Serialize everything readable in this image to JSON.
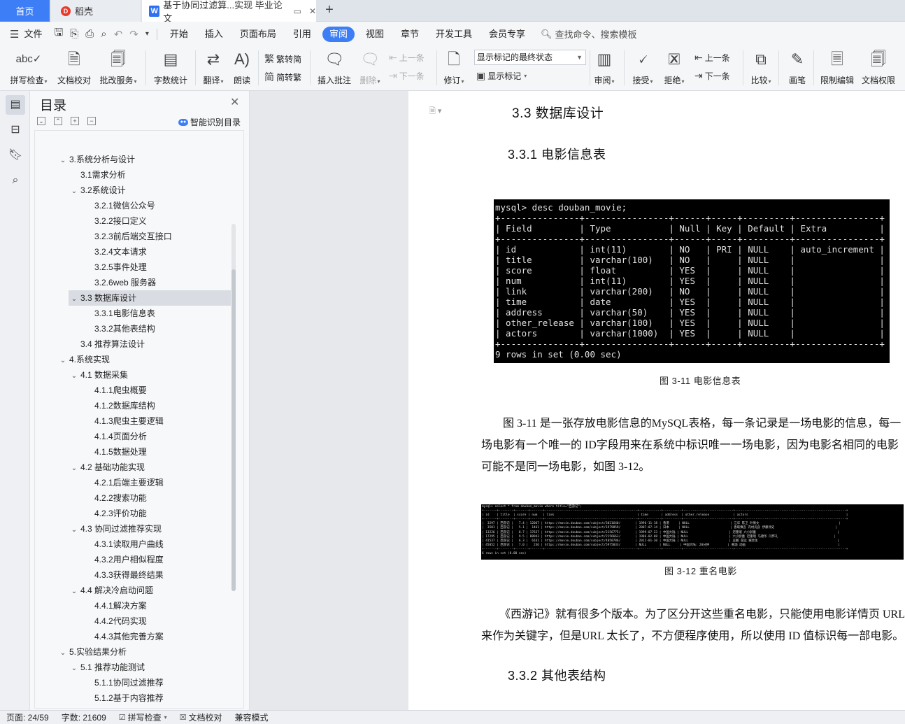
{
  "titlebar": {
    "home_tab": "首页",
    "daoke_tab": "稻壳",
    "doc_tab": "基于协同过滤算...实现 毕业论文",
    "add_tab": "+"
  },
  "menubar": {
    "file": "文件",
    "items": [
      "开始",
      "插入",
      "页面布局",
      "引用",
      "审阅",
      "视图",
      "章节",
      "开发工具",
      "会员专享"
    ],
    "active_item": "审阅",
    "search_placeholder": "查找命令、搜索模板"
  },
  "ribbon": {
    "spell_check": "拼写检查",
    "doc_check": "文档校对",
    "batch_service": "批改服务",
    "word_count": "字数统计",
    "translate": "翻译",
    "read_aloud": "朗读",
    "trad_to_simp_top": "繁转简",
    "simp_to_trad": "简转繁",
    "insert_comment": "插入批注",
    "delete": "删除",
    "prev_comment": "上一条",
    "next_comment": "下一条",
    "track_changes": "修订",
    "markup_state": "显示标记的最终状态",
    "show_markup": "显示标记",
    "review": "审阅",
    "accept": "接受",
    "reject": "拒绝",
    "prev_change": "上一条",
    "next_change": "下一条",
    "compare": "比较",
    "pen": "画笔",
    "restrict_edit": "限制编辑",
    "doc_permission": "文档权限"
  },
  "toc": {
    "title": "目录",
    "smart_toc": "智能识别目录",
    "items": [
      {
        "text": "3.系统分析与设计",
        "level": 1,
        "chevron": true,
        "selected": false
      },
      {
        "text": "3.1需求分析",
        "level": 2,
        "chevron": false,
        "selected": false
      },
      {
        "text": "3.2系统设计",
        "level": 2,
        "chevron": true,
        "selected": false
      },
      {
        "text": "3.2.1微信公众号",
        "level": 3,
        "chevron": false,
        "selected": false
      },
      {
        "text": "3.2.2接口定义",
        "level": 3,
        "chevron": false,
        "selected": false
      },
      {
        "text": "3.2.3前后端交互接口",
        "level": 3,
        "chevron": false,
        "selected": false
      },
      {
        "text": "3.2.4文本请求",
        "level": 3,
        "chevron": false,
        "selected": false
      },
      {
        "text": "3.2.5事件处理",
        "level": 3,
        "chevron": false,
        "selected": false
      },
      {
        "text": "3.2.6web 服务器",
        "level": 3,
        "chevron": false,
        "selected": false
      },
      {
        "text": "3.3 数据库设计",
        "level": 2,
        "chevron": true,
        "selected": true
      },
      {
        "text": "3.3.1电影信息表",
        "level": 3,
        "chevron": false,
        "selected": false
      },
      {
        "text": "3.3.2其他表结构",
        "level": 3,
        "chevron": false,
        "selected": false
      },
      {
        "text": "3.4 推荐算法设计",
        "level": 2,
        "chevron": false,
        "selected": false
      },
      {
        "text": "4.系统实现",
        "level": 1,
        "chevron": true,
        "selected": false
      },
      {
        "text": "4.1 数据采集",
        "level": 2,
        "chevron": true,
        "selected": false
      },
      {
        "text": "4.1.1爬虫概要",
        "level": 3,
        "chevron": false,
        "selected": false
      },
      {
        "text": "4.1.2数据库结构",
        "level": 3,
        "chevron": false,
        "selected": false
      },
      {
        "text": "4.1.3爬虫主要逻辑",
        "level": 3,
        "chevron": false,
        "selected": false
      },
      {
        "text": "4.1.4页面分析",
        "level": 3,
        "chevron": false,
        "selected": false
      },
      {
        "text": "4.1.5数据处理",
        "level": 3,
        "chevron": false,
        "selected": false
      },
      {
        "text": "4.2 基础功能实现",
        "level": 2,
        "chevron": true,
        "selected": false
      },
      {
        "text": "4.2.1后端主要逻辑",
        "level": 3,
        "chevron": false,
        "selected": false
      },
      {
        "text": "4.2.2搜索功能",
        "level": 3,
        "chevron": false,
        "selected": false
      },
      {
        "text": "4.2.3评价功能",
        "level": 3,
        "chevron": false,
        "selected": false
      },
      {
        "text": "4.3 协同过滤推荐实现",
        "level": 2,
        "chevron": true,
        "selected": false
      },
      {
        "text": "4.3.1读取用户曲线",
        "level": 3,
        "chevron": false,
        "selected": false
      },
      {
        "text": "4.3.2用户相似程度",
        "level": 3,
        "chevron": false,
        "selected": false
      },
      {
        "text": "4.3.3获得最终结果",
        "level": 3,
        "chevron": false,
        "selected": false
      },
      {
        "text": "4.4 解决冷启动问题",
        "level": 2,
        "chevron": true,
        "selected": false
      },
      {
        "text": "4.4.1解决方案",
        "level": 3,
        "chevron": false,
        "selected": false
      },
      {
        "text": "4.4.2代码实现",
        "level": 3,
        "chevron": false,
        "selected": false
      },
      {
        "text": "4.4.3其他完善方案",
        "level": 3,
        "chevron": false,
        "selected": false
      },
      {
        "text": "5.实验结果分析",
        "level": 1,
        "chevron": true,
        "selected": false
      },
      {
        "text": "5.1 推荐功能测试",
        "level": 2,
        "chevron": true,
        "selected": false
      },
      {
        "text": "5.1.1协同过滤推荐",
        "level": 3,
        "chevron": false,
        "selected": false
      },
      {
        "text": "5.1.2基于内容推荐",
        "level": 3,
        "chevron": false,
        "selected": false
      }
    ]
  },
  "document": {
    "heading_33": "3.3  数据库设计",
    "heading_331": "3.3.1  电影信息表",
    "terminal1": "mysql> desc douban_movie;\n+---------------+----------------+------+-----+---------+----------------+\n| Field         | Type           | Null | Key | Default | Extra          |\n+---------------+----------------+------+-----+---------+----------------+\n| id            | int(11)        | NO   | PRI | NULL    | auto_increment |\n| title         | varchar(100)   | NO   |     | NULL    |                |\n| score         | float          | YES  |     | NULL    |                |\n| num           | int(11)        | YES  |     | NULL    |                |\n| link          | varchar(200)   | NO   |     | NULL    |                |\n| time          | date           | YES  |     | NULL    |                |\n| address       | varchar(50)    | YES  |     | NULL    |                |\n| other_release | varchar(100)   | YES  |     | NULL    |                |\n| actors        | varchar(1000)  | YES  |     | NULL    |                |\n+---------------+----------------+------+-----+---------+----------------+\n9 rows in set (0.00 sec)",
    "caption_311": "图  3-11  电影信息表",
    "para1_line1": "图 3-11 是一张存放电影信息的MySQL表格，每一条记录是一场电影的信息，每一",
    "para1_line2": "场电影有一个唯一的  ID字段用来在系统中标识唯一一场电影，因为电影名相同的电影",
    "para1_line3": "可能不是同一场电影，如图  3-12。",
    "terminal2": "mysql> select * from douban_movie where title=\"西游记\";\n+-------+--------+-------+-------+--------------------------------------------------+------------+----------+---------------------------+------------------------------------------------------------+\n| id    | title  | score | num   | link                                             | time       | address  | other_release             | actors                                                     |\n+-------+--------+-------+-------+--------------------------------------------------+------------+----------+---------------------------+------------------------------------------------------------+\n|  3297 | 西游记 |   7.4 | 12067 | https://movie.douban.com/subject/3021640/        | 1996-11-18 | 香港     | NULL                      | 江华 陈卫 叶倩文                                           |\n|  3501 | 西游记 |   5.1 |  1461 | https://movie.douban.com/subject/1979859/        | 2007-07-14 | 日本     | NULL                      | 香取慎吾 内村光良 伊藤淳史                                 |\n| 13226 | 西游记 |   8.7 | 17637 | https://movie.douban.com/subject/2156775/        | 1999-07-23 | 中国大陆 | NULL                      | 迟重瑞 六小龄童                                            |\n| 17295 | 西游记 |   9.5 | 80943 | https://movie.douban.com/subject/2156663/        | 1986-02-08 | 中国大陆 | NULL                      | 六小龄童 迟重瑞 马德华 闫怀礼                              |\n| 41537 | 西游记 |   6.3 |  6161 | https://movie.douban.com/subject/4050786/        | 2012-01-30 | 中国大陆 | NULL                      | 吴樾 聂远 臧金生                                           |\n| 45052 | 西游记 |   7.0 |   236 | https://movie.douban.com/subject/5975033/        | NULL       | NULL     | 中国大陆: 20分钟          | 黄渤 动画                                                  |\n+-------+--------+-------+-------+--------------------------------------------------+------------+----------+---------------------------+------------------------------------------------------------+\n6 rows in set (0.00 sec)",
    "caption_312": "图  3-12  重名电影",
    "para2_line1": "《西游记》就有很多个版本。为了区分开这些重名电影，只能使用电影详情页  URL",
    "para2_line2": "来作为关键字，但是URL 太长了，不方便程序使用，所以使用  ID 值标识每一部电影。",
    "heading_332": "3.3.2  其他表结构"
  },
  "statusbar": {
    "page": "页面: 24/59",
    "words": "字数: 21609",
    "spell": "拼写检查",
    "doc_check": "文档校对",
    "compat": "兼容模式"
  },
  "colors": {
    "accent": "#3d7ef6",
    "terminal_bg": "#000000"
  }
}
